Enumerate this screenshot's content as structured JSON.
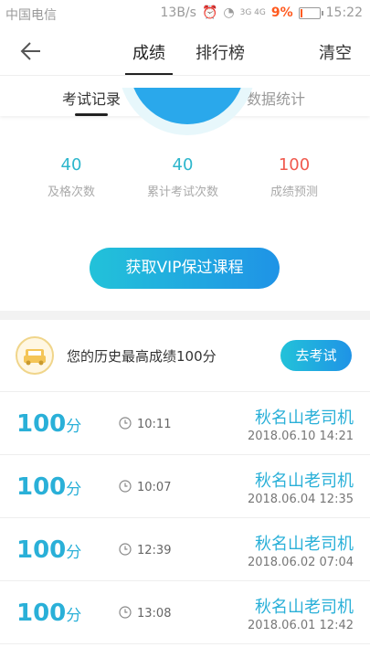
{
  "status": {
    "carrier": "中国电信",
    "speed": "13B/s",
    "network": "3G 4G",
    "battery_pct": "9%",
    "time": "15:22"
  },
  "nav": {
    "tab_score": "成绩",
    "tab_rank": "排行榜",
    "clear": "清空"
  },
  "subtabs": {
    "records": "考试记录",
    "stats": "数据统计"
  },
  "summary": [
    {
      "value": "40",
      "label": "及格次数"
    },
    {
      "value": "40",
      "label": "累计考试次数"
    },
    {
      "value": "100",
      "label": "成绩预测"
    }
  ],
  "vip_button": "获取VIP保过课程",
  "best": {
    "text": "您的历史最高成绩100分",
    "button": "去考试"
  },
  "records": [
    {
      "score": "100",
      "unit": "分",
      "time": "10:11",
      "name": "秋名山老司机",
      "date": "2018.06.10  14:21"
    },
    {
      "score": "100",
      "unit": "分",
      "time": "10:07",
      "name": "秋名山老司机",
      "date": "2018.06.04  12:35"
    },
    {
      "score": "100",
      "unit": "分",
      "time": "12:39",
      "name": "秋名山老司机",
      "date": "2018.06.02  07:04"
    },
    {
      "score": "100",
      "unit": "分",
      "time": "13:08",
      "name": "秋名山老司机",
      "date": "2018.06.01  12:42"
    }
  ],
  "colors": {
    "accent": "#2ab0d8",
    "predict": "#f05a4e",
    "button_start": "#22c2d9",
    "button_end": "#1f93e6"
  }
}
